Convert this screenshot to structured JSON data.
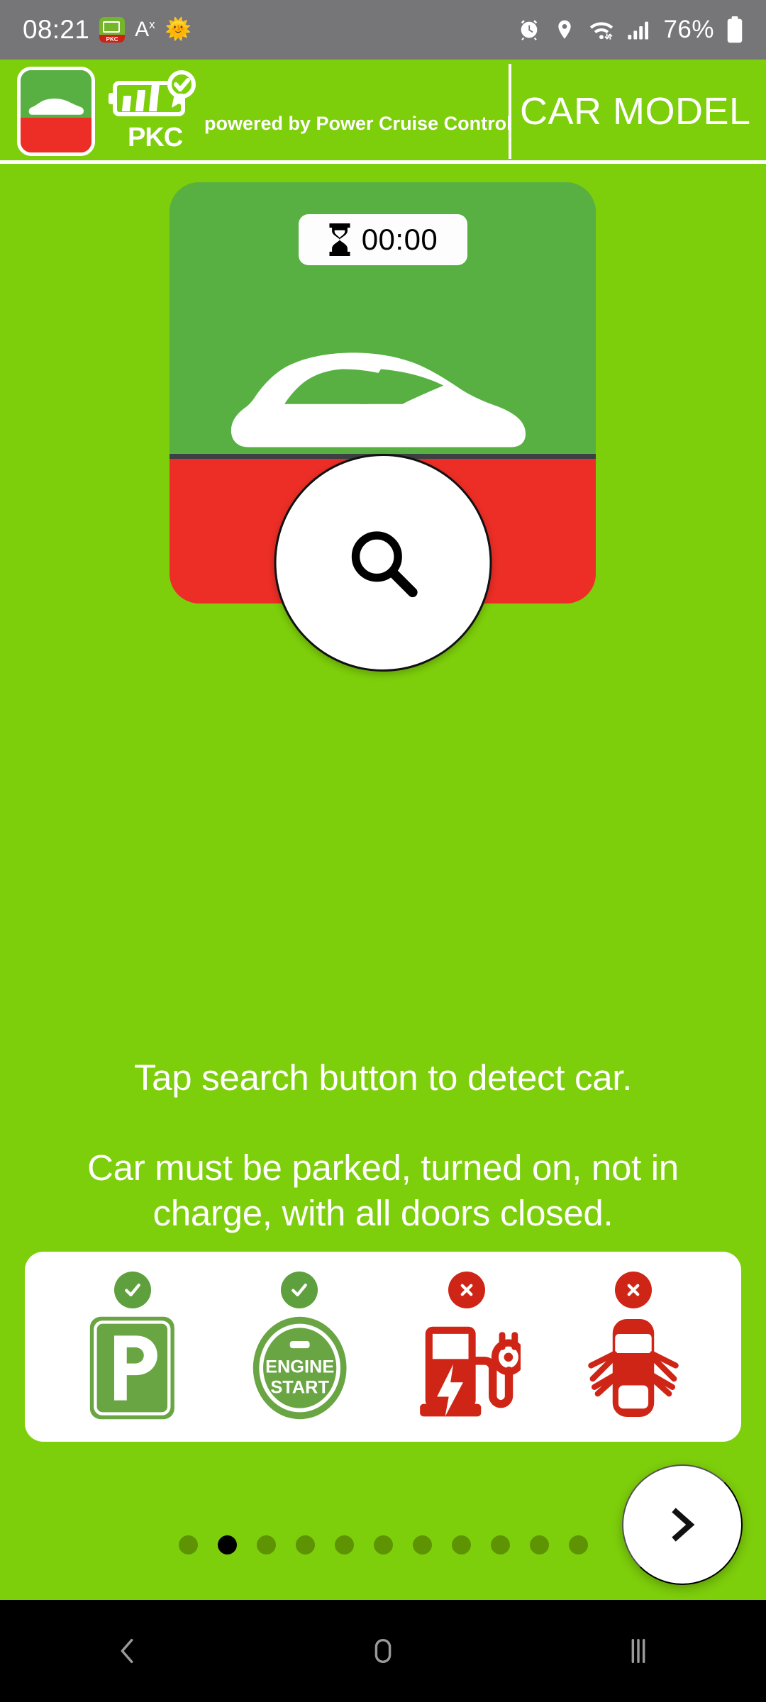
{
  "status_bar": {
    "time": "08:21",
    "pkc_icon_label": "PKC",
    "text_size_icon": "A",
    "text_size_sup": "x",
    "sun_emoji": "🌞",
    "battery_percent": "76%",
    "icons": [
      "alarm-icon",
      "location-icon",
      "wifi-icon",
      "signal-icon",
      "battery-icon"
    ],
    "background_color": "#767679"
  },
  "app_bar": {
    "brand_short": "PKC",
    "powered_by": "powered by Power Cruise Control",
    "title": "CAR MODEL",
    "background_color": "#7dce0b"
  },
  "car_card": {
    "timer": "00:00",
    "timer_icon": "hourglass-icon",
    "top_color": "#57b041",
    "bottom_color": "#ec2e26",
    "search_icon": "search-icon"
  },
  "instructions": {
    "line1": "Tap search button to detect car.",
    "line2": "Car must be parked, turned on, not in charge, with all doors closed."
  },
  "conditions": [
    {
      "id": "parked",
      "status": "ok",
      "badge": "check-icon",
      "graphic": "parking-sign-icon",
      "label": "P"
    },
    {
      "id": "engine-on",
      "status": "ok",
      "badge": "check-icon",
      "graphic": "engine-start-icon",
      "label_line1": "ENGINE",
      "label_line2": "START"
    },
    {
      "id": "not-charging",
      "status": "no",
      "badge": "cross-icon",
      "graphic": "charging-station-icon",
      "label": ""
    },
    {
      "id": "doors-closed",
      "status": "no",
      "badge": "cross-icon",
      "graphic": "car-doors-open-icon",
      "label": ""
    }
  ],
  "pager": {
    "total": 11,
    "active_index": 1,
    "dot_color": "#5e9304",
    "active_dot_color": "#000000"
  },
  "next_button": {
    "icon": "chevron-right-icon"
  },
  "nav_bar": {
    "back": "back-icon",
    "home": "home-icon",
    "recents": "recents-icon",
    "background_color": "#000000"
  },
  "colors": {
    "brand_green": "#7dce0b",
    "card_green": "#57b041",
    "card_red": "#ec2e26",
    "ok_green": "#5da03d",
    "no_red": "#cf2516"
  }
}
